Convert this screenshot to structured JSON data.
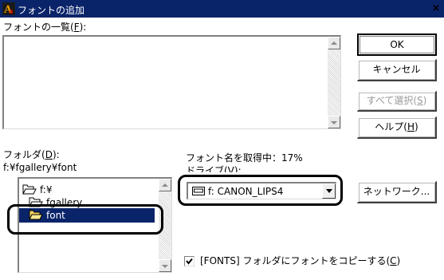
{
  "window": {
    "title": "フォントの追加",
    "close_glyph": "×"
  },
  "font_list": {
    "label": "フォントの一覧",
    "accel_open": "(",
    "accel": "F",
    "accel_close": "):"
  },
  "buttons": {
    "ok": "OK",
    "cancel": "キャンセル",
    "select_all_prefix": "すべて選択(",
    "select_all_accel": "S",
    "help_prefix": "ヘルプ(",
    "help_accel": "H",
    "accel_close": ")",
    "network": "ネットワーク..."
  },
  "folders": {
    "label_prefix": "フォルダ(",
    "label_accel": "D",
    "label_suffix": "):",
    "current_path": "f:¥fgallery¥font",
    "items": [
      {
        "label": "f:¥"
      },
      {
        "label": "fgallery"
      },
      {
        "label": "font"
      }
    ]
  },
  "status": {
    "progress_text": "フォント名を取得中：17%",
    "progress_percent": 17,
    "drives_label": "ドライブ(V):"
  },
  "drive_select": {
    "value": "f: CANON_LIPS4"
  },
  "copy_option": {
    "checked": true,
    "label_prefix": "[FONTS] フォルダにフォントをコピーする(",
    "label_accel": "C",
    "label_suffix": ")"
  },
  "colors": {
    "titlebar": "#0a246a",
    "selection": "#0a246a",
    "background": "#ffffff"
  },
  "icons": {
    "app": "font-app-icon",
    "folder_open": "folder-open-icon",
    "drive": "drive-icon",
    "close": "close-icon",
    "dropdown": "chevron-down-icon"
  }
}
